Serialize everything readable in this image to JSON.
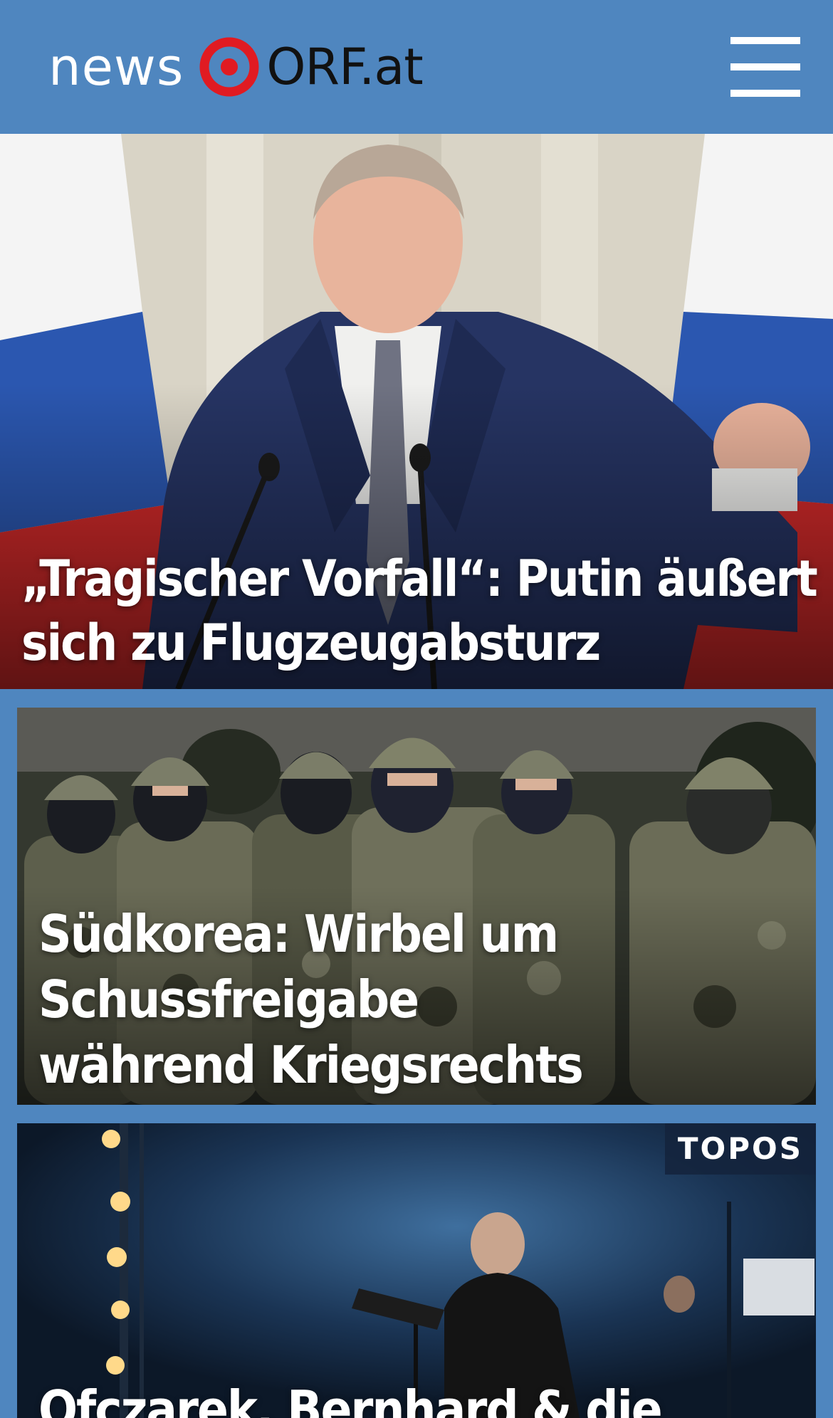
{
  "header": {
    "logo_news": "news",
    "logo_orf": "ORF.at",
    "menu_icon": "hamburger-menu-icon"
  },
  "colors": {
    "header_background": "#4f86bf",
    "logo_ring": "#e01b22"
  },
  "articles": [
    {
      "headline": "„Tragischer Vorfall“: Putin äußert sich zu Flugzeugabsturz",
      "image": "Putin at microphones in front of Russian flags"
    },
    {
      "headline": "Südkorea: Wirbel um Schussfreigabe während Kriegsrechts",
      "image": "Masked soldiers in camouflage with helmets"
    },
    {
      "section": "TOPOS",
      "headline": "Ofczarek, Bernhard & die",
      "image": "Stage performance with spotlights and musicians"
    }
  ]
}
